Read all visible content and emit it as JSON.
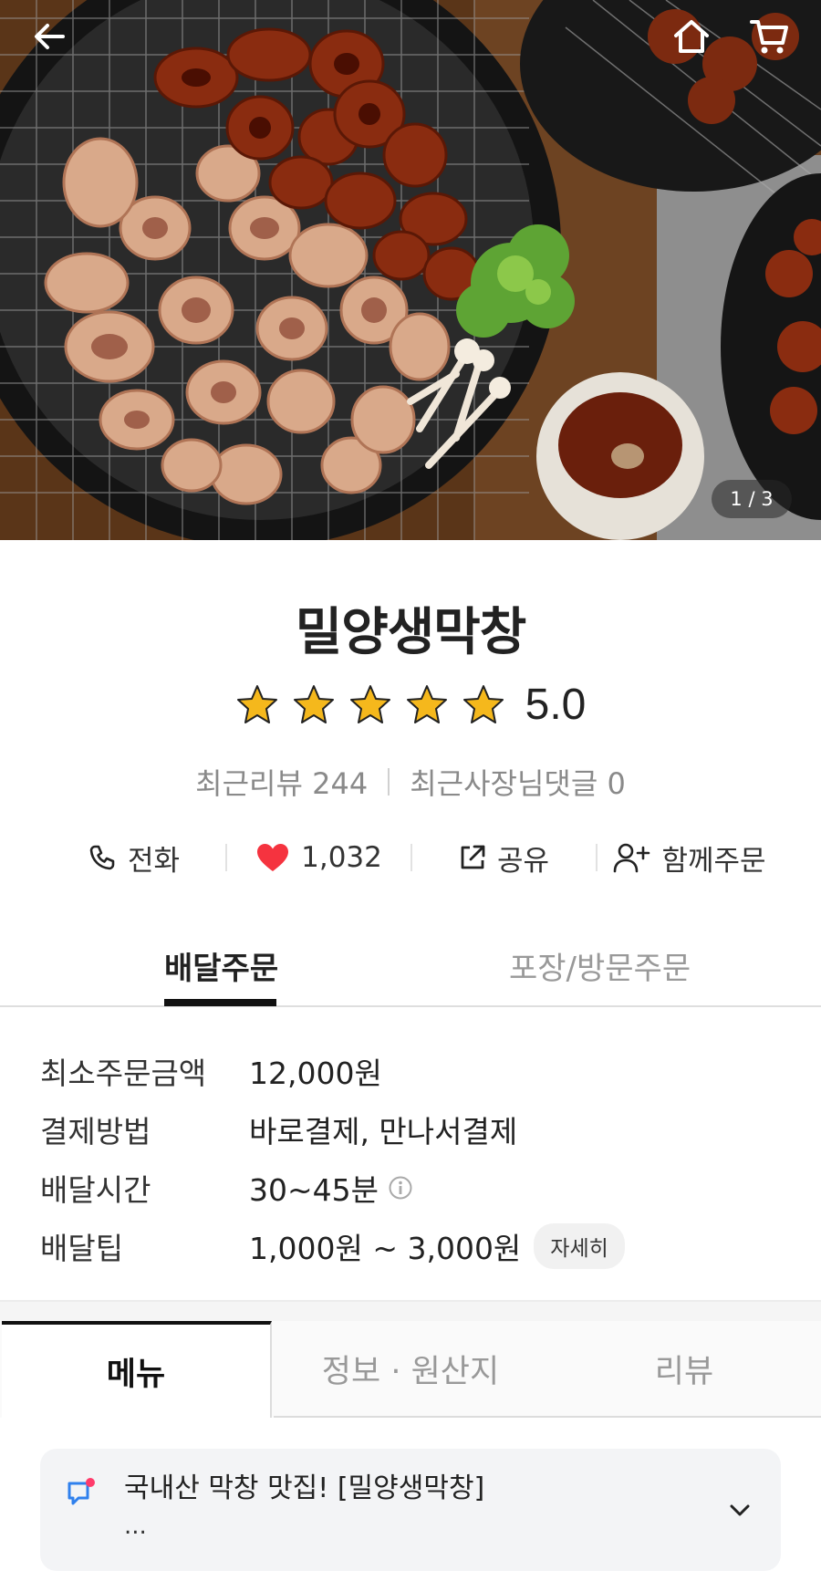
{
  "hero": {
    "page_indicator": "1 / 3"
  },
  "store": {
    "name": "밀양생막창",
    "rating": "5.0",
    "stars": 5,
    "recent_reviews": "최근리뷰 244",
    "owner_replies": "최근사장님댓글 0"
  },
  "actions": {
    "call": "전화",
    "likes": "1,032",
    "share": "공유",
    "group_order": "함께주문"
  },
  "order_tabs": {
    "delivery": "배달주문",
    "pickup": "포장/방문주문"
  },
  "info": {
    "rows": [
      {
        "label": "최소주문금액",
        "value": "12,000원"
      },
      {
        "label": "결제방법",
        "value": "바로결제, 만나서결제"
      },
      {
        "label": "배달시간",
        "value": "30~45분"
      },
      {
        "label": "배달팁",
        "value": "1,000원 ~ 3,000원"
      }
    ],
    "detail_chip": "자세히"
  },
  "main_tabs": {
    "menu": "메뉴",
    "info": "정보 · 원산지",
    "review": "리뷰"
  },
  "notice": {
    "text": "국내산 막창 맛집!  [밀양생막창]",
    "more": "..."
  },
  "colors": {
    "heart": "#f5333f",
    "star": "#f5b81c",
    "notice_icon": "#2f80ed",
    "notice_dot": "#ff3b6b"
  },
  "icons": [
    "back-arrow-icon",
    "home-icon",
    "cart-icon",
    "phone-icon",
    "heart-icon",
    "share-icon",
    "add-user-icon",
    "info-icon",
    "megaphone-icon",
    "chevron-down-icon"
  ]
}
